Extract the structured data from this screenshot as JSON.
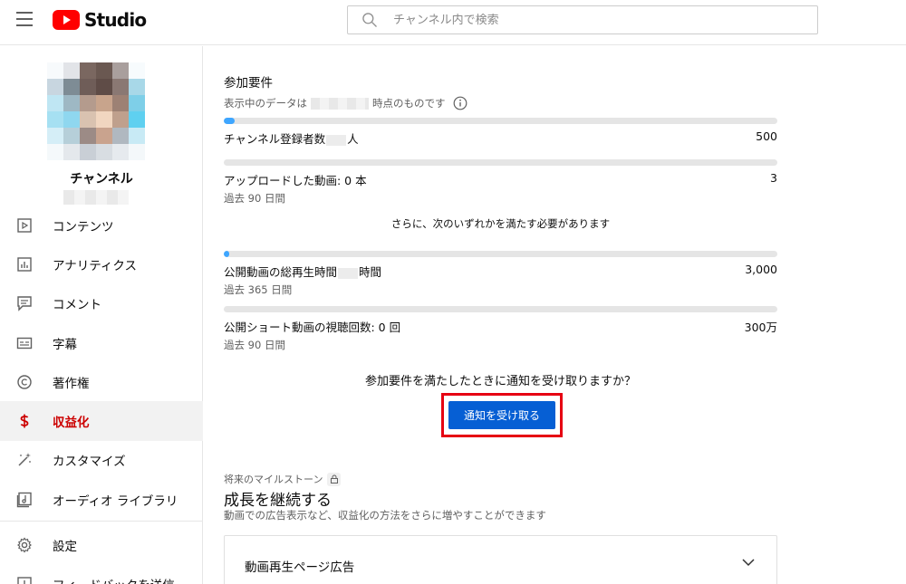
{
  "header": {
    "logo_text": "Studio",
    "search_placeholder": "チャンネル内で検索"
  },
  "sidebar": {
    "channel_name": "チャンネル",
    "items": [
      {
        "label": "コンテンツ",
        "icon": "content-icon",
        "active": false
      },
      {
        "label": "アナリティクス",
        "icon": "analytics-icon",
        "active": false
      },
      {
        "label": "コメント",
        "icon": "comment-icon",
        "active": false
      },
      {
        "label": "字幕",
        "icon": "subtitles-icon",
        "active": false
      },
      {
        "label": "著作権",
        "icon": "copyright-icon",
        "active": false
      },
      {
        "label": "収益化",
        "icon": "dollar-icon",
        "active": true
      },
      {
        "label": "カスタマイズ",
        "icon": "magic-wand-icon",
        "active": false
      },
      {
        "label": "オーディオ ライブラリ",
        "icon": "audio-library-icon",
        "active": false
      }
    ],
    "settings_label": "設定",
    "feedback_label": "フィードバックを送信"
  },
  "main": {
    "section_title": "参加要件",
    "data_note_prefix": "表示中のデータは",
    "data_note_suffix": "時点のものです",
    "requirements": [
      {
        "label_prefix": "チャンネル登録者数",
        "label_suffix": "人",
        "target": "500",
        "progress": 0.02,
        "sub": ""
      },
      {
        "label_prefix": "アップロードした動画: 0 本",
        "label_suffix": "",
        "target": "3",
        "progress": 0,
        "sub": "過去 90 日間"
      },
      {
        "label_prefix": "公開動画の総再生時間",
        "label_suffix": "時間",
        "target": "3,000",
        "progress": 0.01,
        "sub": "過去 365 日間"
      },
      {
        "label_prefix": "公開ショート動画の視聴回数: 0 回",
        "label_suffix": "",
        "target": "300万",
        "progress": 0,
        "sub": "過去 90 日間"
      }
    ],
    "also_text": "さらに、次のいずれかを満たす必要があります",
    "notify_question": "参加要件を満たしたときに通知を受け取りますか？",
    "notify_button": "通知を受け取る",
    "milestone_label": "将来のマイルストーン",
    "milestone_title": "成長を継続する",
    "milestone_desc": "動画での広告表示など、収益化の方法をさらに増やすことができます",
    "card_title": "動画再生ページ広告"
  },
  "colors": {
    "accent_blue": "#065fd4",
    "progress_blue": "#3ea6ff",
    "active_red": "#cc0000",
    "highlight_frame": "#e60012"
  }
}
